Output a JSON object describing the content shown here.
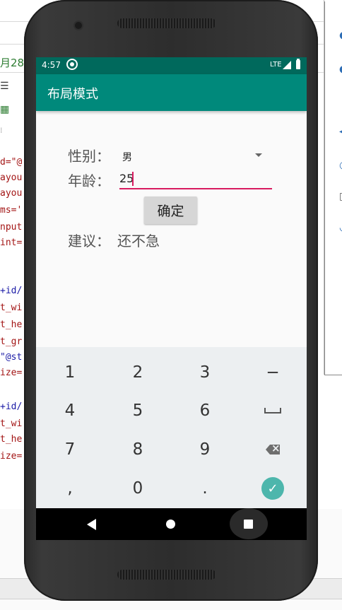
{
  "ide": {
    "date_tab": "月28",
    "code_lines": [
      {
        "text": "d=\"@",
        "color": "red"
      },
      {
        "text": "ayou",
        "color": "red"
      },
      {
        "text": "ayou",
        "color": "red"
      },
      {
        "text": "ms='",
        "color": "red"
      },
      {
        "text": "nput",
        "color": "red"
      },
      {
        "text": "int=",
        "color": "red"
      },
      {
        "text": "+id/",
        "color": "blue"
      },
      {
        "text": "t_wi",
        "color": "red"
      },
      {
        "text": "t_he",
        "color": "red"
      },
      {
        "text": "t_gr",
        "color": "red"
      },
      {
        "text": "\"@st",
        "color": "blue"
      },
      {
        "text": "ize=",
        "color": "red"
      },
      {
        "text": "+id/",
        "color": "blue"
      },
      {
        "text": "t_wi",
        "color": "red"
      },
      {
        "text": "t_he",
        "color": "red"
      },
      {
        "text": "ize=",
        "color": "red"
      }
    ]
  },
  "status_bar": {
    "time": "4:57",
    "network": "LTE"
  },
  "app_bar": {
    "title": "布局模式"
  },
  "form": {
    "gender_label": "性别：",
    "gender_value": "男",
    "age_label": "年龄：",
    "age_value": "25",
    "confirm_label": "确定",
    "advice_label": "建议：",
    "advice_text": "还不急"
  },
  "keyboard": {
    "rows": [
      [
        "1",
        "2",
        "3",
        "−"
      ],
      [
        "4",
        "5",
        "6",
        "space"
      ],
      [
        "7",
        "8",
        "9",
        "backspace"
      ],
      [
        ",",
        "0",
        ".",
        "done"
      ]
    ]
  },
  "colors": {
    "status_bar": "#00695c",
    "app_bar": "#00897b",
    "accent": "#d81b60",
    "done_key": "#4db6ac"
  }
}
